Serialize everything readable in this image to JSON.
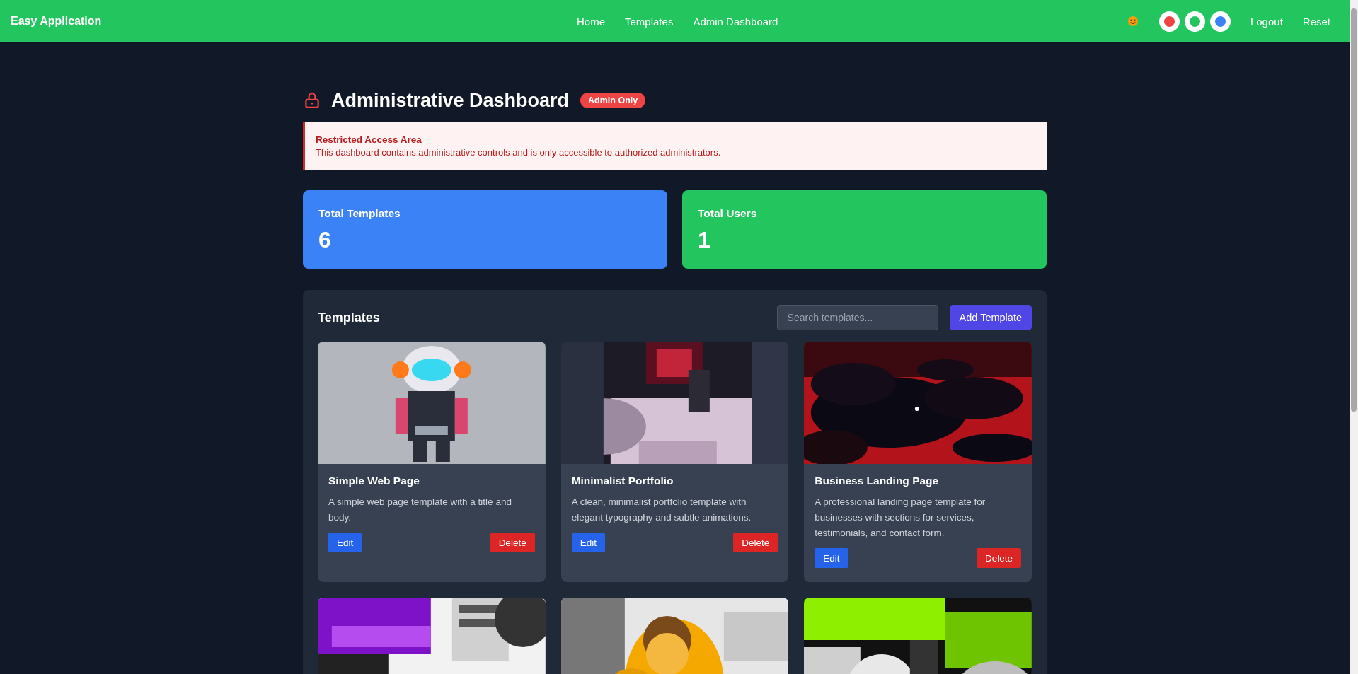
{
  "navbar": {
    "brand": "Easy Application",
    "links": [
      {
        "label": "Home"
      },
      {
        "label": "Templates"
      },
      {
        "label": "Admin Dashboard"
      }
    ],
    "theme_dots": [
      {
        "color": "#ef4444"
      },
      {
        "color": "#22c55e"
      },
      {
        "color": "#3b82f6"
      }
    ],
    "actions": [
      {
        "label": "Logout"
      },
      {
        "label": "Reset"
      }
    ]
  },
  "page": {
    "title": "Administrative Dashboard",
    "badge": "Admin Only"
  },
  "alert": {
    "title": "Restricted Access Area",
    "message": "This dashboard contains administrative controls and is only accessible to authorized administrators."
  },
  "stats": [
    {
      "label": "Total Templates",
      "value": "6",
      "color": "#3b82f6"
    },
    {
      "label": "Total Users",
      "value": "1",
      "color": "#22c55e"
    }
  ],
  "templates": {
    "title": "Templates",
    "search": {
      "placeholder": "Search templates..."
    },
    "add_button": "Add Template",
    "cards": [
      {
        "image": {
          "kind": "picture"
        },
        "title": "Simple Web Page",
        "description": "A simple web page template with a title and body.",
        "edit": "Edit",
        "delete": "Delete"
      },
      {
        "image": {
          "kind": "picture"
        },
        "title": "Minimalist Portfolio",
        "description": "A clean, minimalist portfolio template with elegant typography and subtle animations.",
        "edit": "Edit",
        "delete": "Delete"
      },
      {
        "image": {
          "kind": "picture"
        },
        "title": "Business Landing Page",
        "description": "A professional landing page template for businesses with sections for services, testimonials, and contact form.",
        "edit": "Edit",
        "delete": "Delete"
      },
      {
        "image": {
          "kind": "picture"
        }
      },
      {
        "image": {
          "kind": "picture"
        }
      },
      {
        "image": {
          "kind": "picture"
        }
      }
    ]
  }
}
